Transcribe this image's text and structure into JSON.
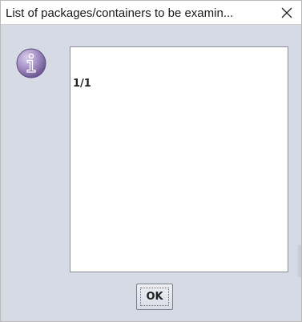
{
  "dialog": {
    "title": "List of packages/containers to be examin...",
    "close_icon": "close-icon",
    "info_icon": "information-icon",
    "message": "1/1",
    "ok_label": "OK"
  },
  "colors": {
    "dialog_background": "#d6dae5",
    "icon_purple": "#9a86b8"
  }
}
